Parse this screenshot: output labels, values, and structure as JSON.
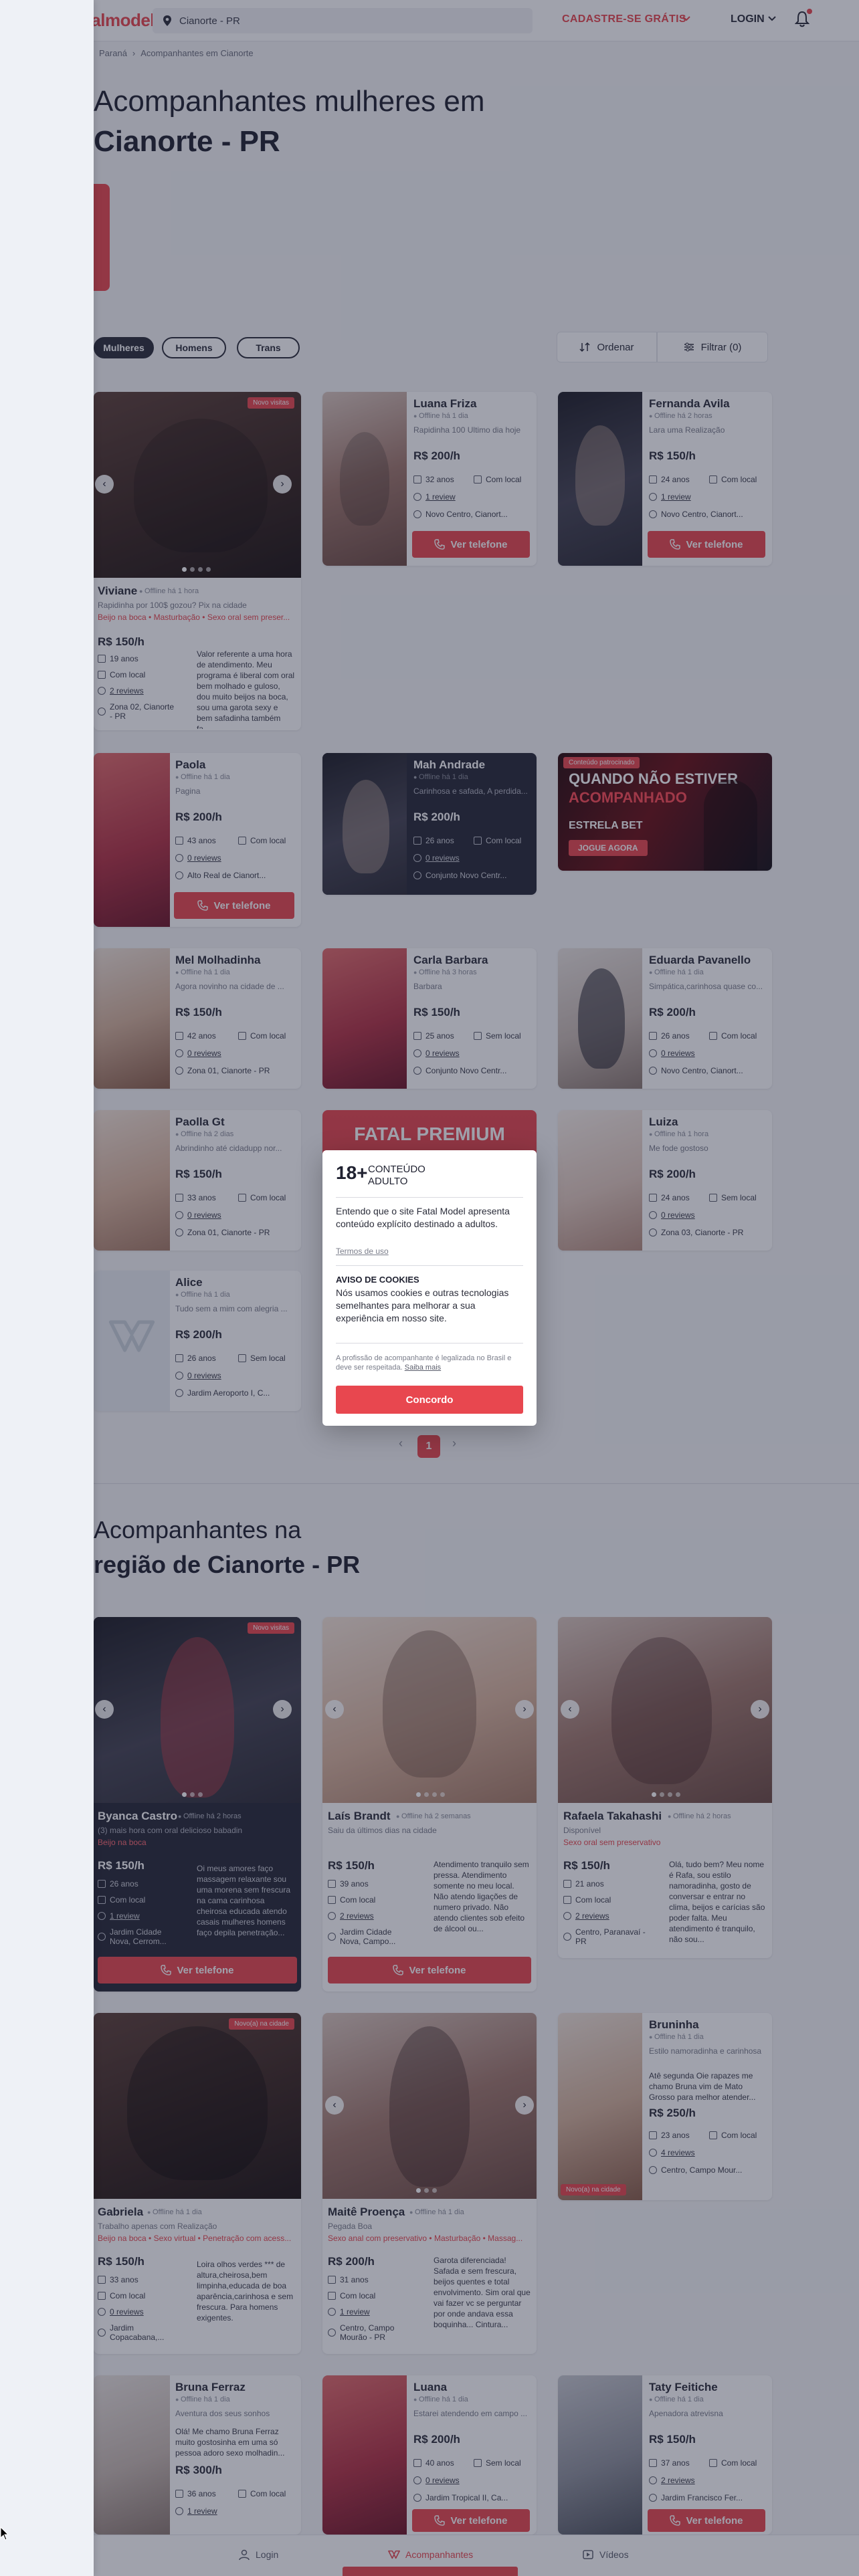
{
  "header": {
    "logo": "fatalmodel",
    "search_value": "Cianorte - PR",
    "signup": "CADASTRE-SE GRÁTIS",
    "login": "LOGIN"
  },
  "breadcrumb": [
    "Paraná",
    "Acompanhantes em Cianorte"
  ],
  "section1": {
    "title_line1": "Acompanhantes mulheres em",
    "title_line2": "Cianorte - PR",
    "chips": [
      "Mulheres",
      "Homens",
      "Trans"
    ],
    "sort": "Ordenar",
    "filter": "Filtrar (0)"
  },
  "common": {
    "view_phone": "Ver telefone"
  },
  "cards1": [
    {
      "name": "Viviane",
      "online": "Offline há 1 hora",
      "subtitle": "Rapidinha por 100$ gozou? Pix na cidade",
      "services": "Beijo na boca • Masturbação • Sexo oral sem preser...",
      "price": "R$ 150/h",
      "age": "19 anos",
      "local": "Com local",
      "reviews": "2 reviews",
      "location": "Zona 02, Cianorte - PR",
      "desc": "Valor referente a uma hora de atendimento. Meu programa é liberal com oral bem molhado e guloso, dou muito beijos na boca, sou uma garota sexy e bem safadinha também fa...",
      "badge": "Novo visitas"
    },
    {
      "name": "Luana Friza",
      "online": "Offline há 1 dia",
      "subtitle": "Rapidinha 100 Ultimo dia hoje",
      "price": "R$ 200/h",
      "age": "32 anos",
      "local": "Com local",
      "reviews": "1 review",
      "location": "Novo Centro, Cianort..."
    },
    {
      "name": "Fernanda Avila",
      "online": "Offline há 2 horas",
      "subtitle": "Lara uma Realização",
      "price": "R$ 150/h",
      "age": "24 anos",
      "local": "Com local",
      "reviews": "1 review",
      "location": "Novo Centro, Cianort..."
    },
    {
      "name": "Paola",
      "online": "Offline há 1 dia",
      "subtitle": "Pagina",
      "price": "R$ 200/h",
      "age": "43 anos",
      "local": "Com local",
      "reviews": "0 reviews",
      "location": "Alto Real de Cianort..."
    },
    {
      "name": "Mah Andrade",
      "online": "Offline há 1 dia",
      "subtitle": "Carinhosa e safada, A perdida...",
      "price": "R$ 200/h",
      "age": "26 anos",
      "local": "Com local",
      "reviews": "0 reviews",
      "location": "Conjunto Novo Centr..."
    },
    {
      "name": "Mel Molhadinha",
      "online": "Offline há 1 dia",
      "subtitle": "Agora novinho na cidade de ...",
      "price": "R$ 150/h",
      "age": "42 anos",
      "local": "Com local",
      "reviews": "0 reviews",
      "location": "Zona 01, Cianorte - PR"
    },
    {
      "name": "Carla Barbara",
      "online": "Offline há 3 horas",
      "subtitle": "Barbara",
      "price": "R$ 150/h",
      "age": "25 anos",
      "local": "Sem local",
      "reviews": "0 reviews",
      "location": "Conjunto Novo Centr..."
    },
    {
      "name": "Eduarda Pavanello",
      "online": "Offline há 1 dia",
      "subtitle": "Simpática,carinhosa quase co...",
      "price": "R$ 200/h",
      "age": "26 anos",
      "local": "Com local",
      "reviews": "0 reviews",
      "location": "Novo Centro, Cianort..."
    },
    {
      "name": "Paolla Gt",
      "online": "Offline há 2 dias",
      "subtitle": "Abrindinho até cidadupp nor...",
      "price": "R$ 150/h",
      "age": "33 anos",
      "local": "Com local",
      "reviews": "0 reviews",
      "location": "Zona 01, Cianorte - PR"
    },
    {
      "name": "Luiza",
      "online": "Offline há 1 hora",
      "subtitle": "Me fode gostoso",
      "price": "R$ 200/h",
      "age": "24 anos",
      "local": "Sem local",
      "reviews": "0 reviews",
      "location": "Zona 03, Cianorte - PR"
    },
    {
      "name": "Alice",
      "online": "Offline há 1 dia",
      "subtitle": "Tudo sem a mim com alegria ...",
      "price": "R$ 200/h",
      "age": "26 anos",
      "local": "Sem local",
      "reviews": "0 reviews",
      "location": "Jardim Aeroporto I, C..."
    }
  ],
  "ad_bet": {
    "badge": "Conteúdo patrocinado",
    "line1": "QUANDO NÃO ESTIVER",
    "line2": "ACOMPANHADO",
    "line3": "ESTRELA BET",
    "line4": "JOGUE AGORA"
  },
  "ad_premium": {
    "title": "FATAL PREMIUM"
  },
  "pagination": {
    "current": "1",
    "prev": "‹",
    "next": "›"
  },
  "section2": {
    "title_line1": "Acompanhantes na",
    "title_line2": "região de Cianorte - PR"
  },
  "cards2": [
    {
      "name": "Byanca Castro",
      "online": "Offline há 2 horas",
      "subtitle": "(3) mais hora com oral delicioso babadin",
      "services": "Beijo na boca",
      "price": "R$ 150/h",
      "age": "26 anos",
      "local": "Com local",
      "reviews": "1 review",
      "location": "Jardim Cidade Nova, Cerrom...",
      "desc": "Oi meus amores faço massagem relaxante sou uma morena sem frescura na cama carinhosa cheirosa educada atendo casais mulheres homens faço depila penetração...",
      "badge": "Novo visitas"
    },
    {
      "name": "Laís Brandt",
      "online": "Offline há 2 semanas",
      "subtitle": "Saiu da últimos dias na cidade",
      "price": "R$ 150/h",
      "age": "39 anos",
      "local": "Com local",
      "reviews": "2 reviews",
      "location": "Jardim Cidade Nova, Campo...",
      "desc": "Atendimento tranquilo sem pressa. Atendimento somente no meu local. Não atendo ligações de numero privado. Não atendo clientes sob efeito de álcool ou..."
    },
    {
      "name": "Rafaela Takahashi",
      "online": "Offline há 2 horas",
      "subtitle": "Disponível",
      "services": "Sexo oral sem preservativo",
      "price": "R$ 150/h",
      "age": "21 anos",
      "local": "Com local",
      "reviews": "2 reviews",
      "location": "Centro, Paranavaí - PR",
      "desc": "Olá, tudo bem? Meu nome é Rafa, sou estilo namoradinha, gosto de conversar e entrar no clima, beijos e carícias são poder falta. Meu atendimento é tranquilo, não sou..."
    },
    {
      "name": "Gabriela",
      "online": "Offline há 1 dia",
      "subtitle": "Trabalho apenas com Realização",
      "services": "Beijo na boca • Sexo virtual • Penetração com acess...",
      "price": "R$ 150/h",
      "age": "33 anos",
      "local": "Com local",
      "reviews": "0 reviews",
      "location": "Jardim Copacabana,...",
      "desc": "Loira olhos verdes *** de altura,cheirosa,bem limpinha,educada de boa aparência,carinhosa e sem frescura. Para homens exigentes.",
      "badge": "Novo(a) na cidade"
    },
    {
      "name": "Maitê Proença",
      "online": "Offline há 1 dia",
      "subtitle": "Pegada Boa",
      "services": "Sexo anal com preservativo • Masturbação • Massag...",
      "price": "R$ 200/h",
      "age": "31 anos",
      "local": "Com local",
      "reviews": "1 review",
      "location": "Centro, Campo Mourão - PR",
      "desc": "Garota diferenciada! Safada e sem frescura, beijos quentes e total envolvimento. Sim oral que vai fazer vc se perguntar por onde andava essa boquinha... Cintura..."
    },
    {
      "name": "Bruninha",
      "online": "Offline há 1 dia",
      "subtitle": "Estilo namoradinha e carinhosa",
      "desc": "Atê segunda Oie rapazes me chamo Bruna vim de Mato Grosso para melhor atender...",
      "price": "R$ 250/h",
      "age": "23 anos",
      "local": "Com local",
      "reviews": "4 reviews",
      "location": "Centro, Campo Mour...",
      "badge": "Novo(a) na cidade"
    },
    {
      "name": "Bruna Ferraz",
      "online": "Offline há 1 dia",
      "subtitle": "Aventura dos seus sonhos",
      "desc": "Olá! Me chamo Bruna Ferraz muito gostosinha em uma só pessoa adoro sexo molhadin...",
      "price": "R$ 300/h",
      "age": "36 anos",
      "local": "Com local",
      "reviews": "1 review"
    },
    {
      "name": "Luana",
      "online": "Offline há 1 dia",
      "subtitle": "Estarei atendendo em campo ...",
      "price": "R$ 200/h",
      "age": "40 anos",
      "local": "Sem local",
      "reviews": "0 reviews",
      "location": "Jardim Tropical II, Ca..."
    },
    {
      "name": "Taty Feitiche",
      "online": "Offline há 1 dia",
      "subtitle": "Apenadora atrevisna",
      "price": "R$ 150/h",
      "age": "37 anos",
      "local": "Com local",
      "reviews": "2 reviews",
      "location": "Jardim Francisco Fer..."
    }
  ],
  "modal": {
    "age": "18+",
    "age_label": "CONTEÚDO ADULTO",
    "text1": "Entendo que o site Fatal Model apresenta conteúdo explícito destinado a adultos.",
    "terms": "Termos de uso",
    "cookie_title": "AVISO DE COOKIES",
    "cookie_text": "Nós usamos cookies e outras tecnologias semelhantes para melhorar a sua experiência em nosso site.",
    "fine": "A profissão de acompanhante é legalizada no Brasil e deve ser respeitada.",
    "fine_link": "Saiba mais",
    "button": "Concordo"
  },
  "bottom_nav": {
    "login": "Login",
    "acompanhantes": "Acompanhantes",
    "videos": "Vídeos"
  },
  "colors": {
    "brand": "#e8474f",
    "dark": "#2b2d3a",
    "overlay": "#1c223a"
  }
}
